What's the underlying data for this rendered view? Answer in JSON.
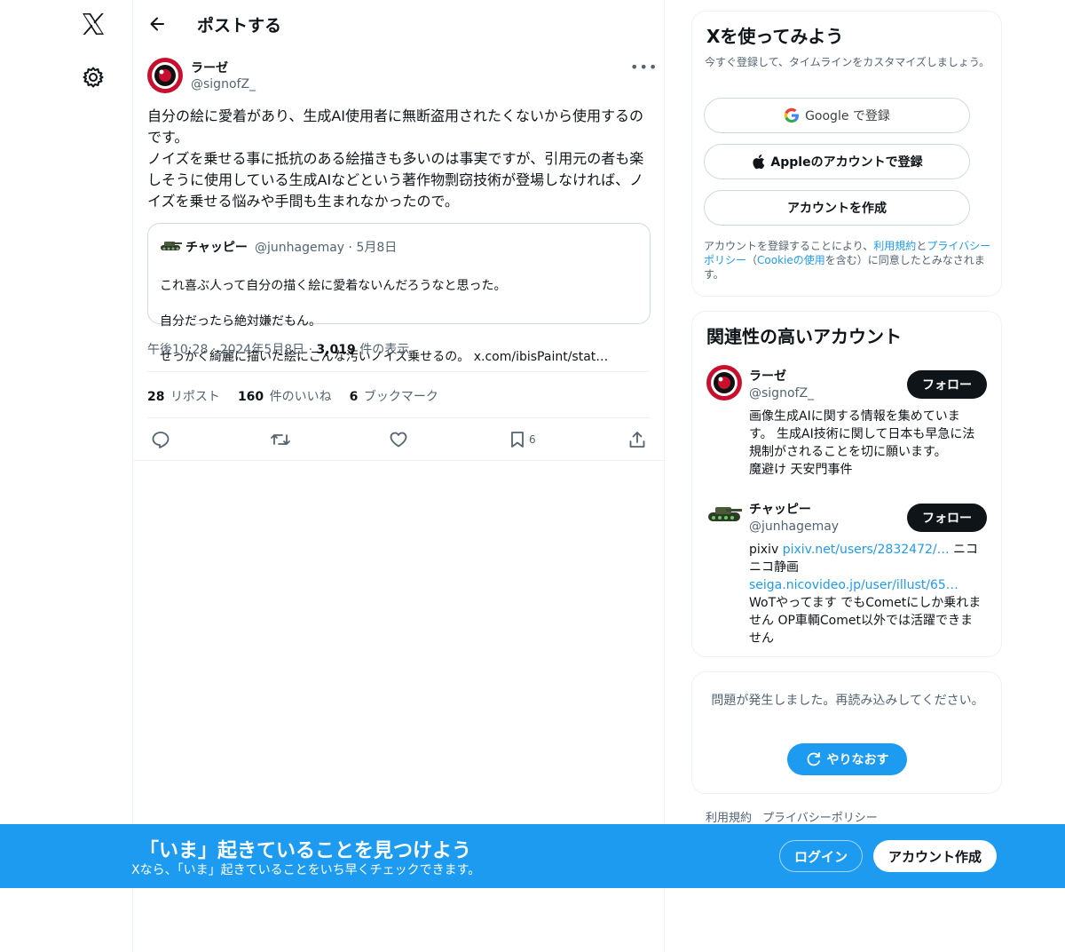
{
  "header": {
    "title": "ポストする"
  },
  "tweet": {
    "author_name": "ラーゼ",
    "author_handle": "@signofZ_",
    "text": "自分の絵に愛着があり、生成AI使用者に無断盗用されたくないから使用するのです。\nノイズを乗せる事に抵抗のある絵描きも多いのは事実ですが、引用元の者も楽しそうに使用している生成AIなどという著作物剽窃技術が登場しなければ、ノイズを乗せる悩みや手間も生まれなかったので。",
    "time": "午後10:28 · 2024年5月8日 · ",
    "views_count": "3,019",
    "views_label": " 件の表示",
    "reposts_count": "28",
    "reposts_label": "リポスト",
    "likes_count": "160",
    "likes_label": "件のいいね",
    "bookmarks_count": "6",
    "bookmarks_label": "ブックマーク",
    "bookmark_action_count": "6"
  },
  "quote": {
    "name": "チャッピー",
    "handle_date": "@junhagemay · 5月8日",
    "line1": "これ喜ぶ人って自分の描く絵に愛着ないんだろうなと思った。",
    "line2": "自分だったら絶対嫌だもん。",
    "line3": "せっかく綺麗に描いた絵にこんな汚いノイズ乗せるの。 x.com/ibisPaint/stat…"
  },
  "signup": {
    "title": "Xを使ってみよう",
    "subtitle": "今すぐ登録して、タイムラインをカスタマイズしましょう。",
    "google_label": "Google で登録",
    "apple_label": "Appleのアカウントで登録",
    "create_label": "アカウントを作成",
    "terms_1": "アカウントを登録することにより、",
    "terms_link1": "利用規約",
    "terms_2": "と",
    "terms_link2": "プライバシーポリシー",
    "terms_3": "（",
    "terms_link3": "Cookieの使用",
    "terms_4": "を含む）に同意したとみなされます。"
  },
  "related": {
    "title": "関連性の高いアカウント",
    "follow_label": "フォロー",
    "accounts": [
      {
        "name": "ラーゼ",
        "handle": "@signofZ_",
        "bio": "画像生成AIに関する情報を集めています。 生成AI技術に関して日本も早急に法規制がされることを切に願います。\n魔避け 天安門事件"
      },
      {
        "name": "チャッピー",
        "handle": "@junhagemay",
        "bio_1": "pixiv ",
        "bio_link1": "pixiv.net/users/2832472/…",
        "bio_2": " ニコニコ静画 ",
        "bio_link2": "seiga.nicovideo.jp/user/illust/65…",
        "bio_3": "WoTやってます でもCometにしか乗れません OP車輌Comet以外では活躍できません"
      }
    ]
  },
  "error": {
    "message": "問題が発生しました。再読み込みしてください。",
    "retry_label": "やりなおす"
  },
  "footer": {
    "terms": "利用規約",
    "privacy": "プライバシーポリシー"
  },
  "bottom_bar": {
    "title": "「いま」起きていることを見つけよう",
    "subtitle": "Xなら、「いま」起きていることをいち早くチェックできます。",
    "login_label": "ログイン",
    "create_label": "アカウント作成"
  },
  "colors": {
    "accent": "#1d9bf0",
    "text": "#0f1419",
    "muted": "#536471",
    "border": "#eff3f4"
  }
}
